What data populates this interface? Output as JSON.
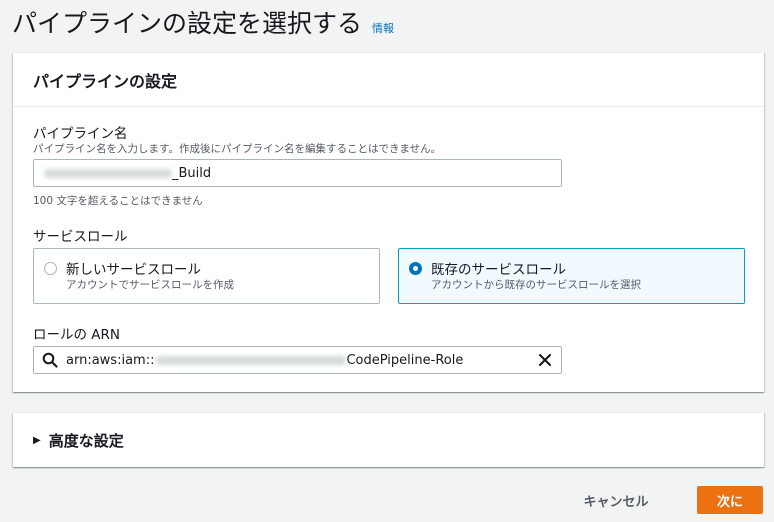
{
  "page": {
    "title": "パイプラインの設定を選択する",
    "info_link": "情報"
  },
  "pipeline_settings": {
    "header": "パイプラインの設定",
    "name_field": {
      "label": "パイプライン名",
      "description": "パイプライン名を入力します。作成後にパイプライン名を編集することはできません。",
      "value_suffix": "_Build",
      "constraint": "100 文字を超えることはできません"
    },
    "service_role": {
      "label": "サービスロール",
      "options": [
        {
          "label": "新しいサービスロール",
          "description": "アカウントでサービスロールを作成",
          "selected": false
        },
        {
          "label": "既存のサービスロール",
          "description": "アカウントから既存のサービスロールを選択",
          "selected": true
        }
      ]
    },
    "role_arn": {
      "label": "ロールの ARN",
      "value_prefix": "arn:aws:iam::",
      "value_suffix": "CodePipeline-Role"
    }
  },
  "advanced": {
    "label": "高度な設定"
  },
  "footer": {
    "cancel_label": "キャンセル",
    "next_label": "次に"
  },
  "colors": {
    "primary_button": "#ec7211",
    "link": "#0073bb",
    "selected_border": "#00a1c9",
    "selected_bg": "#f1faff"
  }
}
